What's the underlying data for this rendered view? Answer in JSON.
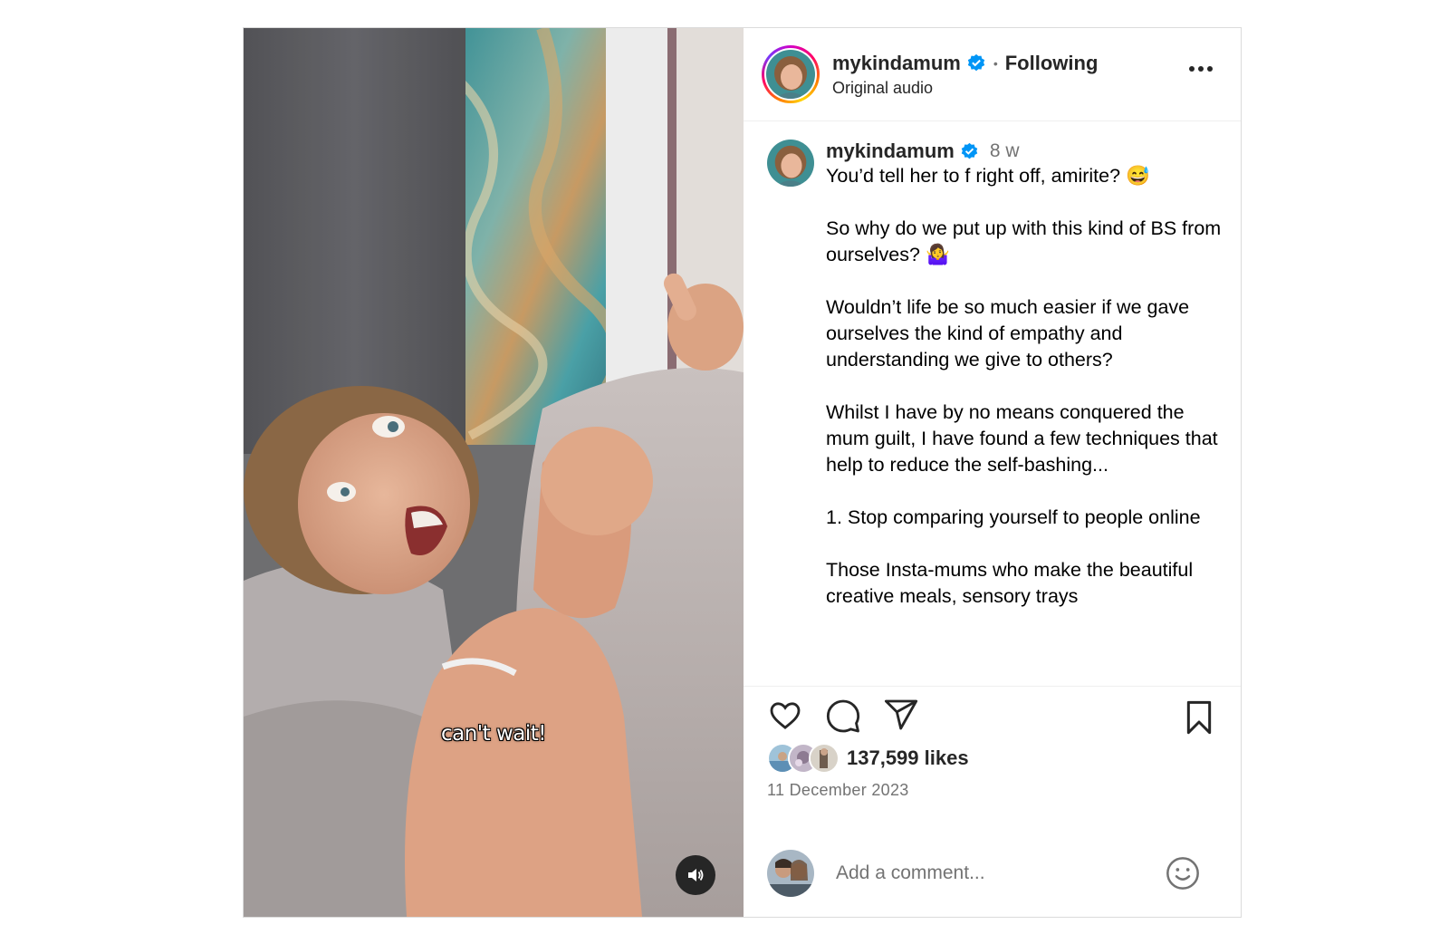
{
  "header": {
    "username": "mykindamum",
    "separator": "•",
    "follow_state": "Following",
    "audio_label": "Original audio"
  },
  "media": {
    "overlay_text": "can't wait!",
    "sound_icon": "speaker-icon"
  },
  "caption": {
    "username": "mykindamum",
    "time_ago": "8 w",
    "paragraphs": [
      "You’d tell her to f right off, amirite? 😅",
      "So why do we put up with this kind of BS from ourselves? 🤷‍♀️",
      "Wouldn’t life be so much easier if we gave ourselves the kind of empathy and understanding we give to others?",
      "Whilst I have by no means conquered the mum guilt, I have found a few techniques that help to reduce the self-bashing...",
      "1. Stop comparing yourself to people online",
      "Those Insta-mums who make the beautiful creative meals, sensory trays"
    ]
  },
  "actions": {
    "icons": [
      "heart-icon",
      "comment-icon",
      "share-icon",
      "bookmark-icon"
    ]
  },
  "stats": {
    "likes": "137,599 likes",
    "date": "11 December 2023"
  },
  "comment": {
    "placeholder": "Add a comment...",
    "emoji_icon": "smiley-icon"
  },
  "colors": {
    "verified": "#0095f6",
    "text": "#262626",
    "muted": "#737373",
    "border": "#dbdbdb"
  }
}
